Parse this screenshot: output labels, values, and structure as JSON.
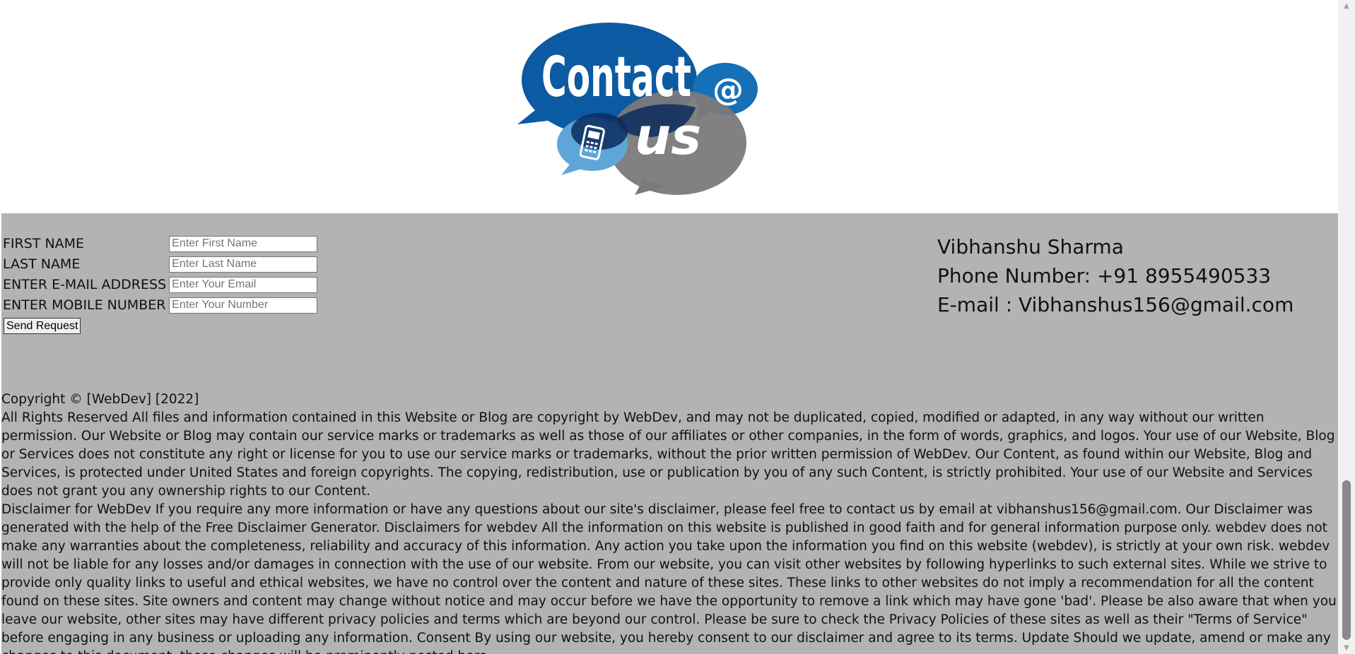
{
  "logo": {
    "alt": "Contact us",
    "word1": "Contact",
    "word2": "us",
    "at_symbol": "@",
    "icon": "phone-icon"
  },
  "form": {
    "first_name": {
      "label": "FIRST NAME",
      "placeholder": "Enter First Name"
    },
    "last_name": {
      "label": "LAST NAME",
      "placeholder": "Enter Last Name"
    },
    "email": {
      "label": "ENTER E-MAIL ADDRESS",
      "placeholder": "Enter Your Email"
    },
    "mobile": {
      "label": "ENTER MOBILE NUMBER",
      "placeholder": "Enter Your Number"
    },
    "submit_label": "Send Request"
  },
  "contact_info": {
    "name": "Vibhanshu Sharma",
    "phone": "Phone Number: +91 8955490533",
    "email": "E-mail : Vibhanshus156@gmail.com"
  },
  "footer": {
    "copyright": "Copyright © [WebDev] [2022]",
    "rights": "All Rights Reserved All files and information contained in this Website or Blog are copyright by WebDev, and may not be duplicated, copied, modified or adapted, in any way without our written permission. Our Website or Blog may contain our service marks or trademarks as well as those of our affiliates or other companies, in the form of words, graphics, and logos. Your use of our Website, Blog or Services does not constitute any right or license for you to use our service marks or trademarks, without the prior written permission of WebDev. Our Content, as found within our Website, Blog and Services, is protected under United States and foreign copyrights. The copying, redistribution, use or publication by you of any such Content, is strictly prohibited. Your use of our Website and Services does not grant you any ownership rights to our Content.",
    "disclaimer": "Disclaimer for WebDev If you require any more information or have any questions about our site's disclaimer, please feel free to contact us by email at vibhanshus156@gmail.com. Our Disclaimer was generated with the help of the Free Disclaimer Generator. Disclaimers for webdev All the information on this website is published in good faith and for general information purpose only. webdev does not make any warranties about the completeness, reliability and accuracy of this information. Any action you take upon the information you find on this website (webdev), is strictly at your own risk. webdev will not be liable for any losses and/or damages in connection with the use of our website. From our website, you can visit other websites by following hyperlinks to such external sites. While we strive to provide only quality links to useful and ethical websites, we have no control over the content and nature of these sites. These links to other websites do not imply a recommendation for all the content found on these sites. Site owners and content may change without notice and may occur before we have the opportunity to remove a link which may have gone 'bad'. Please be also aware that when you leave our website, other sites may have different privacy policies and terms which are beyond our control. Please be sure to check the Privacy Policies of these sites as well as their \"Terms of Service\" before engaging in any business or uploading any information. Consent By using our website, you hereby consent to our disclaimer and agree to its terms. Update Should we update, amend or make any changes to this document, those changes will be prominently posted here."
  },
  "colors": {
    "logo_blue_dark": "#0c5aa2",
    "logo_blue_light": "#5fa6d8",
    "logo_navy": "#0a2c5e",
    "logo_gray": "#7a7a7a",
    "section_bg": "#b3b3b3"
  }
}
